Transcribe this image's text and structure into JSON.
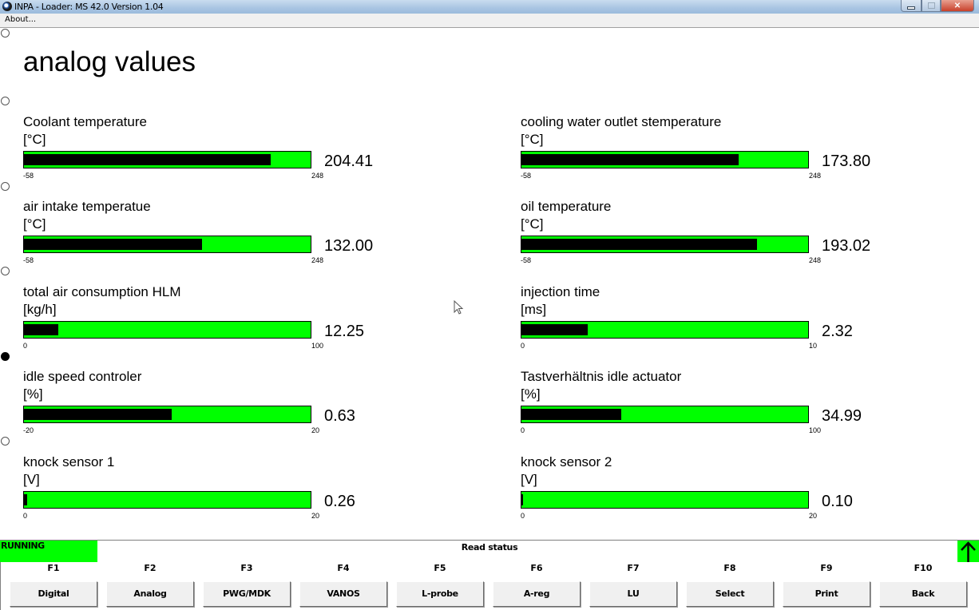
{
  "window": {
    "title": "INPA - Loader:  MS 42.0 Version 1.04",
    "icon": "bmw-logo-icon",
    "controls": [
      "minimize",
      "maximize",
      "close"
    ]
  },
  "menu": {
    "items": [
      {
        "label": "About..."
      }
    ]
  },
  "page": {
    "title": "analog values"
  },
  "radios": [
    {
      "selected": false
    },
    {
      "selected": false
    },
    {
      "selected": false
    },
    {
      "selected": false
    },
    {
      "selected": true
    },
    {
      "selected": false
    }
  ],
  "gauges": [
    {
      "label": "Coolant temperature",
      "unit": "[°C]",
      "value": "204.41",
      "value_num": 204.41,
      "min": -58,
      "max": 248,
      "min_label": "-58",
      "max_label": "248"
    },
    {
      "label": "cooling water outlet stemperature",
      "unit": "[°C]",
      "value": "173.80",
      "value_num": 173.8,
      "min": -58,
      "max": 248,
      "min_label": "-58",
      "max_label": "248"
    },
    {
      "label": "air intake temperatue",
      "unit": "[°C]",
      "value": "132.00",
      "value_num": 132.0,
      "min": -58,
      "max": 248,
      "min_label": "-58",
      "max_label": "248"
    },
    {
      "label": "oil temperature",
      "unit": "[°C]",
      "value": "193.02",
      "value_num": 193.02,
      "min": -58,
      "max": 248,
      "min_label": "-58",
      "max_label": "248"
    },
    {
      "label": "total air consumption HLM",
      "unit": "[kg/h]",
      "value": "12.25",
      "value_num": 12.25,
      "min": 0,
      "max": 100,
      "min_label": "0",
      "max_label": "100"
    },
    {
      "label": "injection time",
      "unit": "[ms]",
      "value": "2.32",
      "value_num": 2.32,
      "min": 0,
      "max": 10,
      "min_label": "0",
      "max_label": "10"
    },
    {
      "label": "idle speed controler",
      "unit": "[%]",
      "value": "0.63",
      "value_num": 0.63,
      "min": -20,
      "max": 20,
      "min_label": "-20",
      "max_label": "20"
    },
    {
      "label": "Tastverhältnis idle actuator",
      "unit": "[%]",
      "value": "34.99",
      "value_num": 34.99,
      "min": 0,
      "max": 100,
      "min_label": "0",
      "max_label": "100"
    },
    {
      "label": "knock sensor 1",
      "unit": "[V]",
      "value": "0.26",
      "value_num": 0.26,
      "min": 0,
      "max": 20,
      "min_label": "0",
      "max_label": "20"
    },
    {
      "label": "knock sensor 2",
      "unit": "[V]",
      "value": "0.10",
      "value_num": 0.1,
      "min": 0,
      "max": 20,
      "min_label": "0",
      "max_label": "20"
    }
  ],
  "status": {
    "state": "RUNNING",
    "state_color": "#00ff00",
    "message": "Read status",
    "arrow_icon": "up-arrow-icon"
  },
  "function_keys": [
    {
      "key": "F1",
      "label": "Digital"
    },
    {
      "key": "F2",
      "label": "Analog"
    },
    {
      "key": "F3",
      "label": "PWG/MDK"
    },
    {
      "key": "F4",
      "label": "VANOS"
    },
    {
      "key": "F5",
      "label": "L-probe"
    },
    {
      "key": "F6",
      "label": "A-reg"
    },
    {
      "key": "F7",
      "label": "LU"
    },
    {
      "key": "F8",
      "label": "Select"
    },
    {
      "key": "F9",
      "label": "Print"
    },
    {
      "key": "F10",
      "label": "Back"
    }
  ],
  "colors": {
    "bar_background": "#00ff00",
    "bar_fill": "#000000"
  }
}
